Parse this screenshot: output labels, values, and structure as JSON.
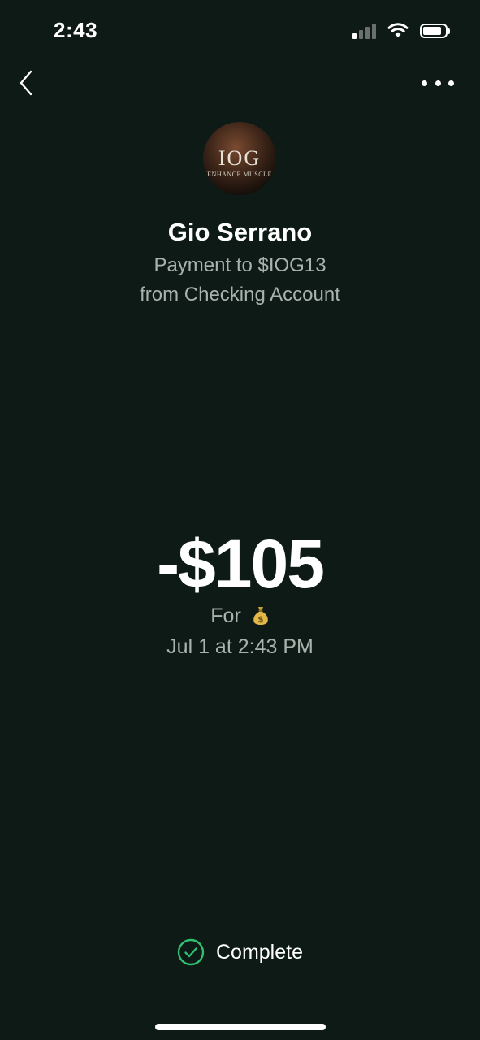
{
  "status_bar": {
    "time": "2:43"
  },
  "nav": {
    "back_icon": "chevron-left-icon",
    "more_icon": "more-horizontal-icon"
  },
  "avatar": {
    "logo_text": "IOG",
    "logo_subtext": "ENHANCE MUSCLE"
  },
  "payment": {
    "recipient_name": "Gio Serrano",
    "description_line1": "Payment to $IOG13",
    "description_line2": "from Checking Account",
    "amount": "-$105",
    "memo_prefix": "For",
    "memo_emoji": "money-bag-icon",
    "date": "Jul 1 at 2:43 PM",
    "status": "Complete"
  },
  "colors": {
    "background": "#0d1a15",
    "secondary_text": "#a9b2ad",
    "success": "#2fbf71"
  }
}
